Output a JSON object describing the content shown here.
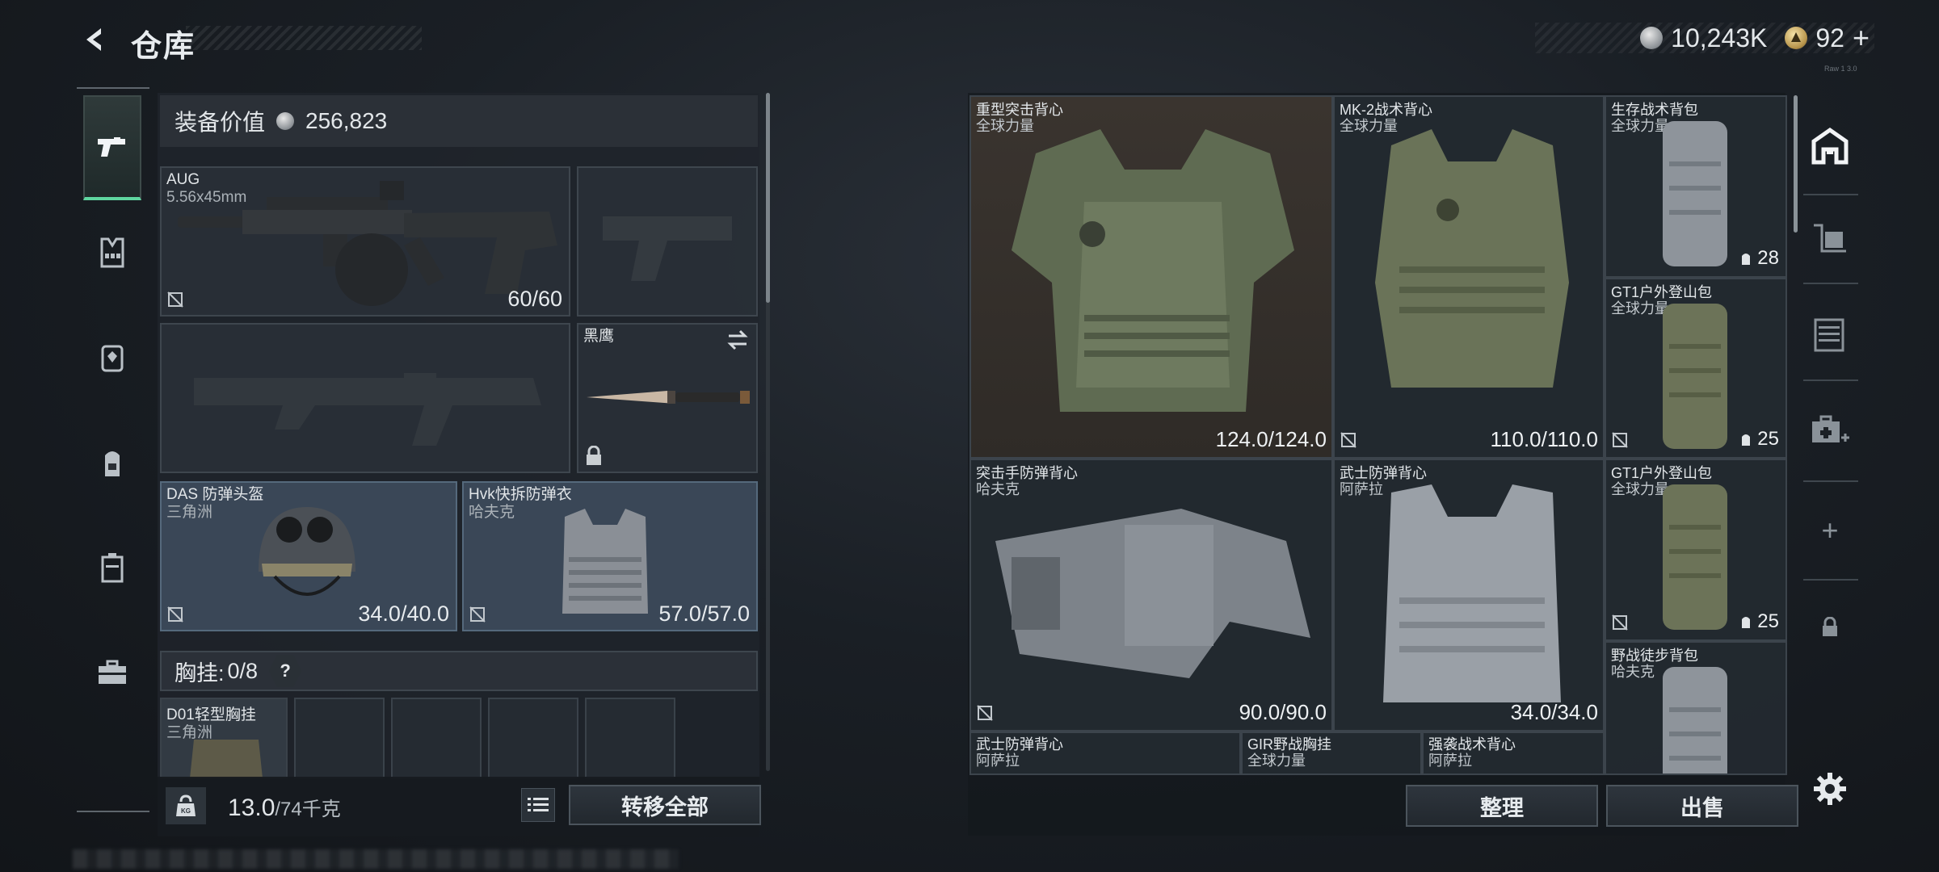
{
  "header": {
    "title": "仓库",
    "currencies": [
      {
        "icon": "silver-coin-icon",
        "value": "10,243K"
      },
      {
        "icon": "gold-coin-icon",
        "value": "92"
      }
    ],
    "add_symbol": "+",
    "tiny_text": "Raw 1 3.0"
  },
  "left_rail": {
    "items": [
      {
        "icon": "pistol-icon",
        "active": true
      },
      {
        "icon": "vest-icon",
        "active": false
      },
      {
        "icon": "helmet-icon",
        "active": false
      },
      {
        "icon": "backpack-icon",
        "active": false
      },
      {
        "icon": "case-icon",
        "active": false
      },
      {
        "icon": "toolbox-icon",
        "active": false
      }
    ]
  },
  "equipment": {
    "value_label": "装备价值",
    "value_amount": "256,823",
    "primary_weapon": {
      "name": "AUG",
      "sub": "5.56x45mm",
      "durability": "60/60"
    },
    "knife": {
      "name": "黑鹰"
    },
    "helmet": {
      "name": "DAS 防弹头盔",
      "sub": "三角洲",
      "durability": "34.0/40.0"
    },
    "armor": {
      "name": "Hvk快拆防弹衣",
      "sub": "哈夫克",
      "durability": "57.0/57.0"
    },
    "chest_rig_label": "胸挂:",
    "chest_rig_count": "0/8",
    "chest_rig_help": "?",
    "chest_rig_item": {
      "name": "D01轻型胸挂",
      "sub": "三角洲"
    },
    "weight_value": "13.0",
    "weight_max": "/74千克",
    "weight_icon_label": "KG",
    "transfer_all_label": "转移全部"
  },
  "storage": {
    "items": [
      {
        "name": "重型突击背心",
        "sub": "全球力量",
        "durability": "124.0/124.0"
      },
      {
        "name": "MK-2战术背心",
        "sub": "全球力量",
        "durability": "110.0/110.0"
      },
      {
        "name": "生存战术背包",
        "sub": "全球力量",
        "capacity": "28"
      },
      {
        "name": "GT1户外登山包",
        "sub": "全球力量",
        "capacity": "25"
      },
      {
        "name": "突击手防弹背心",
        "sub": "哈夫克",
        "durability": "90.0/90.0"
      },
      {
        "name": "武士防弹背心",
        "sub": "阿萨拉",
        "durability": "34.0/34.0"
      },
      {
        "name": "GT1户外登山包",
        "sub": "全球力量",
        "capacity": "25"
      },
      {
        "name": "野战徒步背包",
        "sub": "哈夫克"
      },
      {
        "name": "武士防弹背心",
        "sub": "阿萨拉"
      },
      {
        "name": "GIR野战胸挂",
        "sub": "全球力量"
      },
      {
        "name": "强袭战术背心",
        "sub": "阿萨拉"
      }
    ],
    "sort_label": "整理",
    "sell_label": "出售"
  },
  "right_rail": {
    "items": [
      {
        "icon": "storage-home-icon"
      },
      {
        "icon": "shelf-icon"
      },
      {
        "icon": "rack-icon"
      },
      {
        "icon": "medical-case-add-icon"
      },
      {
        "icon": "plus-icon",
        "symbol": "+"
      },
      {
        "icon": "lock-icon"
      },
      {
        "icon": "settings-gear-icon"
      }
    ]
  },
  "colors": {
    "accent_green": "#5fd6a0",
    "panel": "#20252b",
    "slot_blue": "#3c4a5a",
    "brown_highlight": "#3a342f"
  }
}
